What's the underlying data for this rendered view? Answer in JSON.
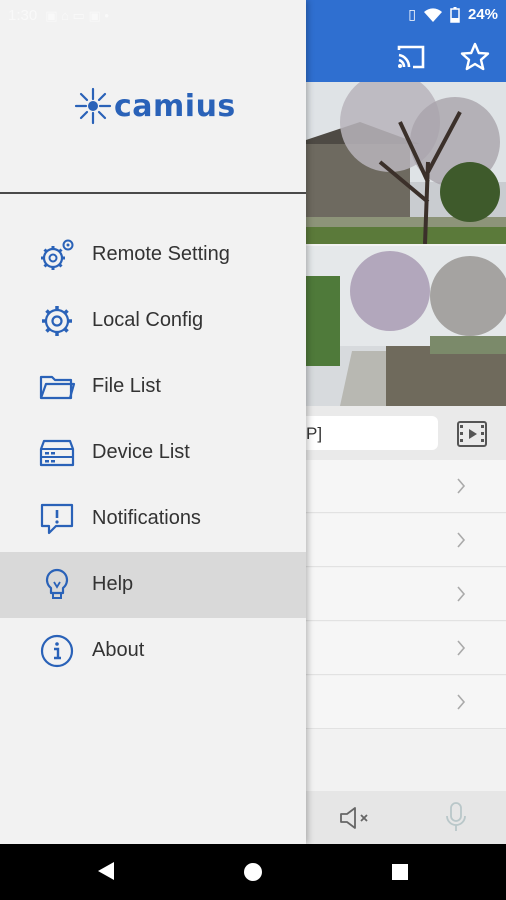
{
  "status_bar": {
    "time": "1:30",
    "battery_text": "24%"
  },
  "colors": {
    "brand_blue": "#2f6fd0",
    "icon_blue": "#2a62b8",
    "drawer_bg": "#f2f2f2",
    "active_bg": "#d9d9d9"
  },
  "app_bar": {
    "cast_icon": "cast-icon",
    "favorite_icon": "star-outline-icon"
  },
  "stream": {
    "selector_text": "P]"
  },
  "drawer": {
    "brand": "camius",
    "menu": [
      {
        "label": "Remote Setting",
        "icon": "remote-settings-icon"
      },
      {
        "label": "Local Config",
        "icon": "gear-icon"
      },
      {
        "label": "File List",
        "icon": "folder-icon"
      },
      {
        "label": "Device List",
        "icon": "device-icon"
      },
      {
        "label": "Notifications",
        "icon": "notification-icon"
      },
      {
        "label": "Help",
        "icon": "lightbulb-icon",
        "active": true
      },
      {
        "label": "About",
        "icon": "info-icon"
      }
    ]
  }
}
